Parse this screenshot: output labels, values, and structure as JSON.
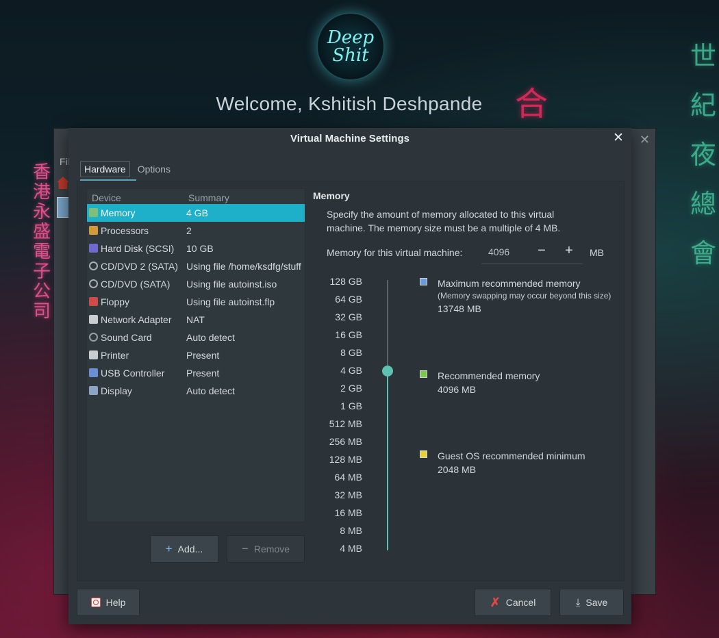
{
  "desktop": {
    "avatar_text": "Deep Shit",
    "welcome": "Welcome, Kshitish Deshpande",
    "neon_left": "香港永盛電子公司",
    "neon_right": "世紀夜總會",
    "neon_red": "合",
    "bg_window_menu": "Fil"
  },
  "dialog": {
    "title": "Virtual Machine Settings",
    "tabs": [
      "Hardware",
      "Options"
    ],
    "columns": {
      "device": "Device",
      "summary": "Summary"
    },
    "devices": [
      {
        "name": "Memory",
        "summary": "4 GB",
        "icon": "memory-icon",
        "color": "#7ec07a"
      },
      {
        "name": "Processors",
        "summary": "2",
        "icon": "processor-icon",
        "color": "#d49a3a"
      },
      {
        "name": "Hard Disk (SCSI)",
        "summary": "10 GB",
        "icon": "hard-disk-icon",
        "color": "#6f6ad0"
      },
      {
        "name": "CD/DVD 2 (SATA)",
        "summary": "Using file /home/ksdfg/stuff",
        "icon": "cd-icon",
        "color": "#a9b0b5"
      },
      {
        "name": "CD/DVD (SATA)",
        "summary": "Using file autoinst.iso",
        "icon": "cd-icon",
        "color": "#a9b0b5"
      },
      {
        "name": "Floppy",
        "summary": "Using file autoinst.flp",
        "icon": "floppy-icon",
        "color": "#d04a4a"
      },
      {
        "name": "Network Adapter",
        "summary": "NAT",
        "icon": "network-icon",
        "color": "#c8cdd0"
      },
      {
        "name": "Sound Card",
        "summary": "Auto detect",
        "icon": "sound-card-icon",
        "color": "#9aa1a6"
      },
      {
        "name": "Printer",
        "summary": "Present",
        "icon": "printer-icon",
        "color": "#c8cdd0"
      },
      {
        "name": "USB Controller",
        "summary": "Present",
        "icon": "usb-icon",
        "color": "#6a8fd4"
      },
      {
        "name": "Display",
        "summary": "Auto detect",
        "icon": "display-icon",
        "color": "#8da4c6"
      }
    ],
    "add_label": "Add...",
    "remove_label": "Remove",
    "memory": {
      "heading": "Memory",
      "description": "Specify the amount of memory allocated to this virtual machine. The memory size must be a multiple of 4 MB.",
      "field_label": "Memory for this virtual machine:",
      "value": "4096",
      "unit": "MB",
      "minus": "−",
      "plus": "+",
      "scale": [
        "128 GB",
        "64 GB",
        "32 GB",
        "16 GB",
        "8 GB",
        "4 GB",
        "2 GB",
        "1 GB",
        "512 MB",
        "256 MB",
        "128 MB",
        "64 MB",
        "32 MB",
        "16 MB",
        "8 MB",
        "4 MB"
      ],
      "selected_step": "4 GB",
      "legend": [
        {
          "label": "Maximum recommended memory",
          "note": "(Memory swapping may occur beyond this size)",
          "value": "13748 MB",
          "color": "#6d9bd8"
        },
        {
          "label": "Recommended memory",
          "note": "",
          "value": "4096 MB",
          "color": "#7cc84a"
        },
        {
          "label": "Guest OS recommended minimum",
          "note": "",
          "value": "2048 MB",
          "color": "#e8d23a"
        }
      ]
    },
    "footer": {
      "help": "Help",
      "cancel": "Cancel",
      "save": "Save"
    }
  }
}
